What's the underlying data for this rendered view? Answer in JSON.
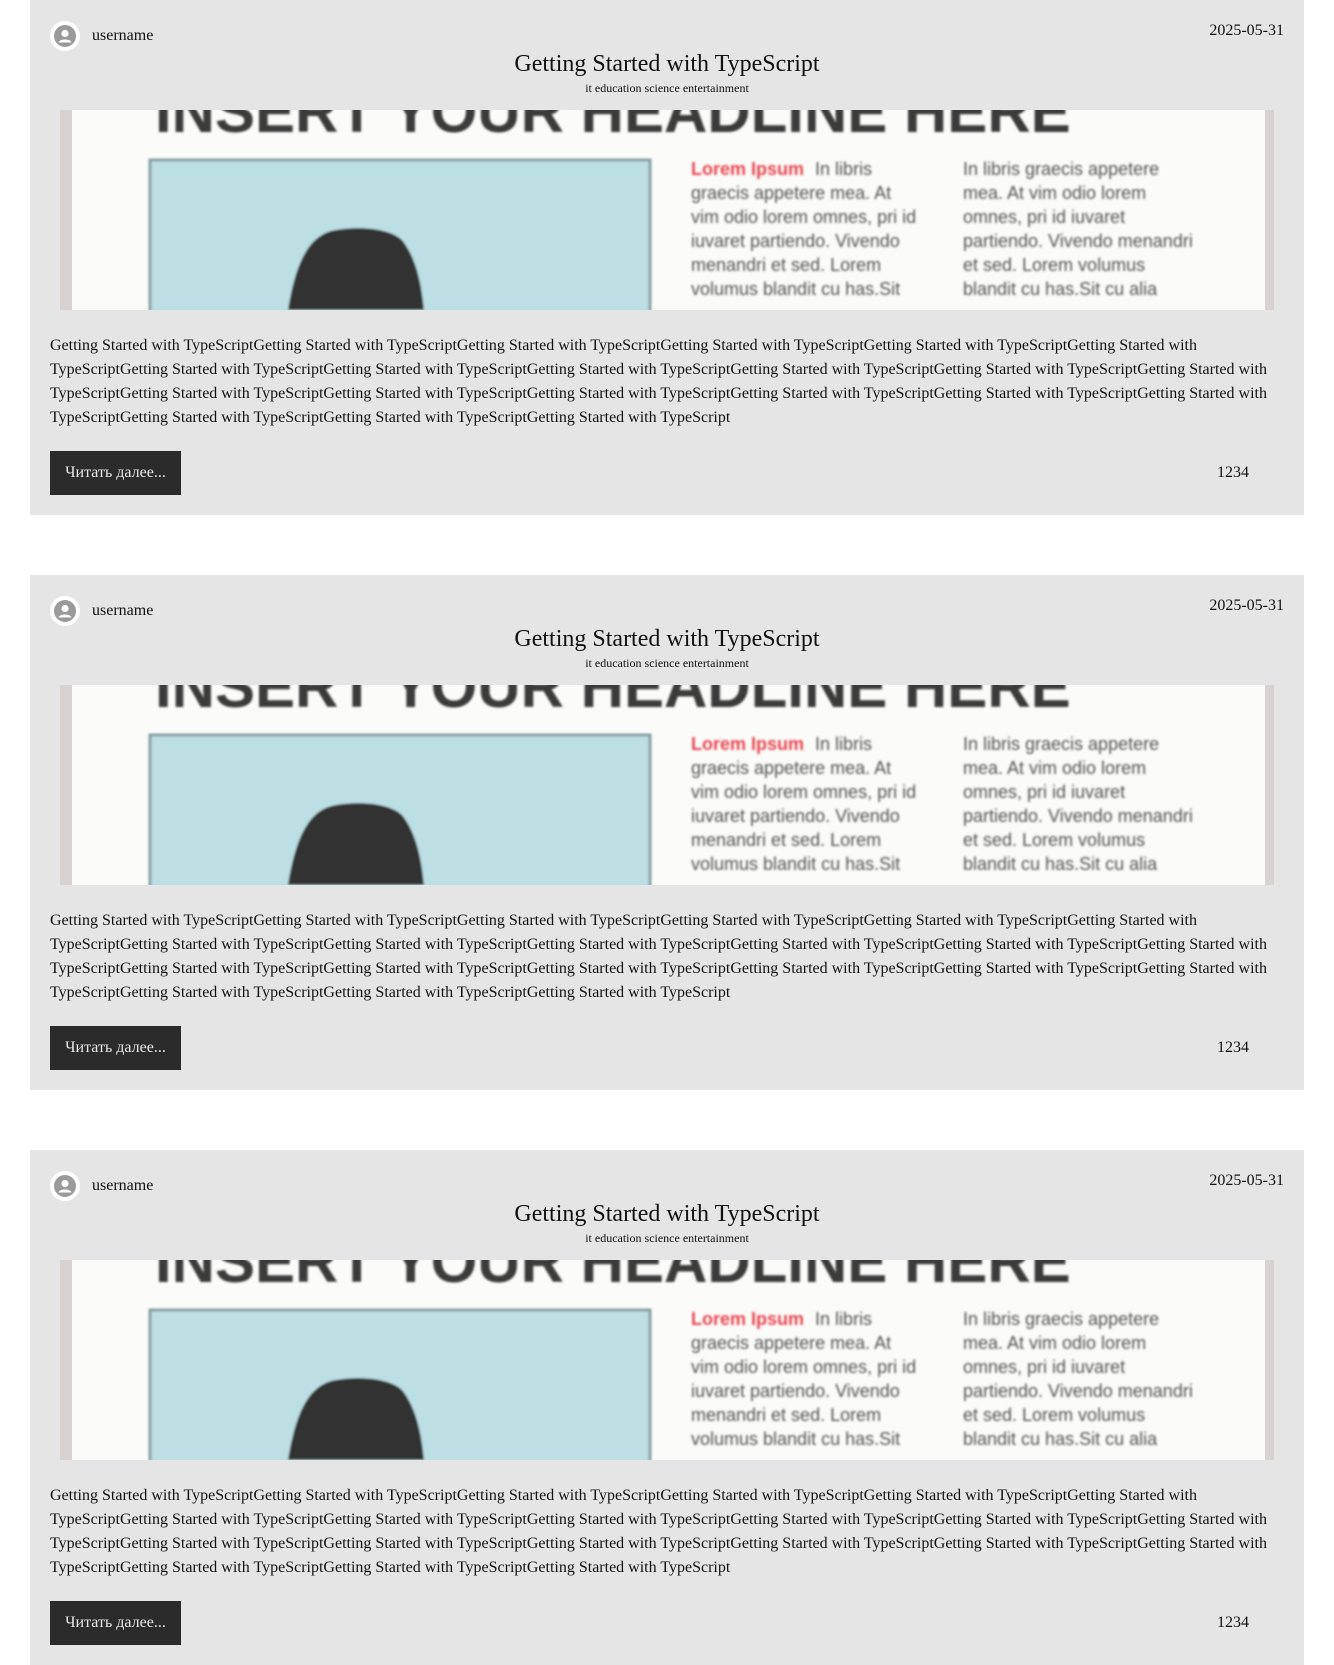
{
  "posts": [
    {
      "author": "username",
      "date": "2025-05-31",
      "title": "Getting Started with TypeScript",
      "tags": "it education science entertainment",
      "image": {
        "headline": "INSERT YOUR HEADLINE HERE",
        "lead": "Lorem Ipsum",
        "col1": [
          "In libris",
          "graecis appetere mea. At",
          "vim odio lorem omnes, pri id",
          "iuvaret partiendo. Vivendo",
          "menandri et sed. Lorem",
          "volumus blandit cu has.Sit"
        ],
        "col2": [
          "In libris graecis appetere",
          "mea. At vim odio lorem",
          "omnes, pri id iuvaret",
          "partiendo. Vivendo menandri",
          "et sed. Lorem volumus",
          "blandit cu has.Sit cu alia"
        ]
      },
      "excerpt": "Getting Started with TypeScriptGetting Started with TypeScriptGetting Started with TypeScriptGetting Started with TypeScriptGetting Started with TypeScriptGetting Started with TypeScriptGetting Started with TypeScriptGetting Started with TypeScriptGetting Started with TypeScriptGetting Started with TypeScriptGetting Started with TypeScriptGetting Started with TypeScriptGetting Started with TypeScriptGetting Started with TypeScriptGetting Started with TypeScriptGetting Started with TypeScriptGetting Started with TypeScriptGetting Started with TypeScriptGetting Started with TypeScriptGetting Started with TypeScriptGetting Started with TypeScript",
      "read_more": "Читать далее...",
      "views": "1234"
    },
    {
      "author": "username",
      "date": "2025-05-31",
      "title": "Getting Started with TypeScript",
      "tags": "it education science entertainment",
      "image": {
        "headline": "INSERT YOUR HEADLINE HERE",
        "lead": "Lorem Ipsum",
        "col1": [
          "In libris",
          "graecis appetere mea. At",
          "vim odio lorem omnes, pri id",
          "iuvaret partiendo. Vivendo",
          "menandri et sed. Lorem",
          "volumus blandit cu has.Sit"
        ],
        "col2": [
          "In libris graecis appetere",
          "mea. At vim odio lorem",
          "omnes, pri id iuvaret",
          "partiendo. Vivendo menandri",
          "et sed. Lorem volumus",
          "blandit cu has.Sit cu alia"
        ]
      },
      "excerpt": "Getting Started with TypeScriptGetting Started with TypeScriptGetting Started with TypeScriptGetting Started with TypeScriptGetting Started with TypeScriptGetting Started with TypeScriptGetting Started with TypeScriptGetting Started with TypeScriptGetting Started with TypeScriptGetting Started with TypeScriptGetting Started with TypeScriptGetting Started with TypeScriptGetting Started with TypeScriptGetting Started with TypeScriptGetting Started with TypeScriptGetting Started with TypeScriptGetting Started with TypeScriptGetting Started with TypeScriptGetting Started with TypeScriptGetting Started with TypeScriptGetting Started with TypeScript",
      "read_more": "Читать далее...",
      "views": "1234"
    },
    {
      "author": "username",
      "date": "2025-05-31",
      "title": "Getting Started with TypeScript",
      "tags": "it education science entertainment",
      "image": {
        "headline": "INSERT YOUR HEADLINE HERE",
        "lead": "Lorem Ipsum",
        "col1": [
          "In libris",
          "graecis appetere mea. At",
          "vim odio lorem omnes, pri id",
          "iuvaret partiendo. Vivendo",
          "menandri et sed. Lorem",
          "volumus blandit cu has.Sit"
        ],
        "col2": [
          "In libris graecis appetere",
          "mea. At vim odio lorem",
          "omnes, pri id iuvaret",
          "partiendo. Vivendo menandri",
          "et sed. Lorem volumus",
          "blandit cu has.Sit cu alia"
        ]
      },
      "excerpt": "Getting Started with TypeScriptGetting Started with TypeScriptGetting Started with TypeScriptGetting Started with TypeScriptGetting Started with TypeScriptGetting Started with TypeScriptGetting Started with TypeScriptGetting Started with TypeScriptGetting Started with TypeScriptGetting Started with TypeScriptGetting Started with TypeScriptGetting Started with TypeScriptGetting Started with TypeScriptGetting Started with TypeScriptGetting Started with TypeScriptGetting Started with TypeScriptGetting Started with TypeScriptGetting Started with TypeScriptGetting Started with TypeScriptGetting Started with TypeScriptGetting Started with TypeScript",
      "read_more": "Читать далее...",
      "views": "1234"
    }
  ],
  "colors": {
    "card_bg": "#e5e5e5",
    "button_bg": "#2b2b2b",
    "image_accent": "#e8474f",
    "image_panel": "#bcdfe3"
  },
  "icons": {
    "avatar": "user-avatar-icon"
  }
}
